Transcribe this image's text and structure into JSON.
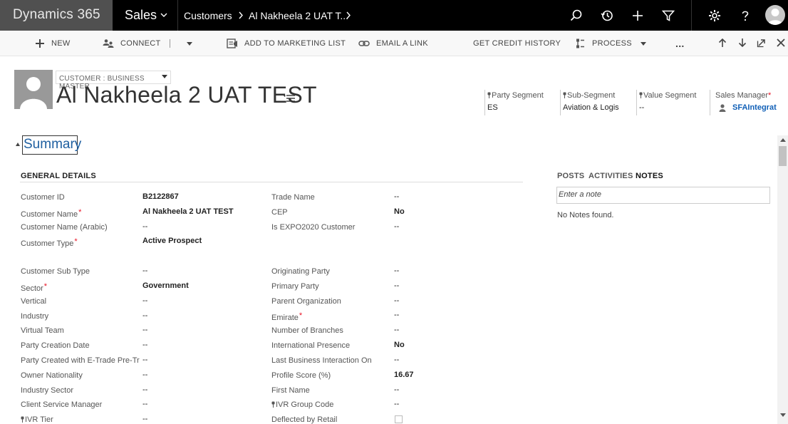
{
  "nav": {
    "brand": "Dynamics 365",
    "area": "Sales",
    "breadcrumb": [
      "Customers",
      "Al Nakheela 2 UAT T..."
    ],
    "icons": [
      "search-icon",
      "history-icon",
      "plus-icon",
      "filter-icon",
      "gear-icon",
      "help-icon",
      "user-avatar"
    ]
  },
  "commands": {
    "new": "NEW",
    "connect": "CONNECT",
    "add_to_marketing_list": "ADD TO MARKETING LIST",
    "email_a_link": "EMAIL A LINK",
    "get_credit_history": "GET CREDIT HISTORY",
    "process": "PROCESS",
    "more": "..."
  },
  "header": {
    "form_selector": "CUSTOMER : BUSINESS MASTER",
    "title": "Al Nakheela 2 UAT TEST",
    "fields": [
      {
        "label": "Party Segment",
        "value": "ES",
        "locked": true
      },
      {
        "label": "Sub-Segment",
        "value": "Aviation & Logis",
        "locked": true
      },
      {
        "label": "Value Segment",
        "value": "--",
        "locked": true
      },
      {
        "label": "Sales Manager",
        "value": "SFAIntegratio",
        "required": true
      }
    ]
  },
  "summary": {
    "title": "Summary",
    "general_details_title": "GENERAL DETAILS",
    "left_fields": [
      {
        "label": "Customer ID",
        "value": "B2122867",
        "bold": true
      },
      {
        "label": "Customer Name",
        "value": "Al Nakheela 2 UAT TEST",
        "bold": true,
        "required": true
      },
      {
        "label": "Customer Name (Arabic)",
        "value": "--"
      },
      {
        "label": "Customer Type",
        "value": "Active Prospect",
        "bold": true,
        "required": true
      },
      {
        "label": "Customer Sub Type",
        "value": "--"
      },
      {
        "label": "Sector",
        "value": "Government",
        "bold": true,
        "required": true
      },
      {
        "label": "Vertical",
        "value": "--"
      },
      {
        "label": "Industry",
        "value": "--"
      },
      {
        "label": "Virtual Team",
        "value": "--"
      },
      {
        "label": "Party Creation Date",
        "value": "--"
      },
      {
        "label": "Party Created with E-Trade Pre-Tr",
        "value": "--"
      },
      {
        "label": "Owner Nationality",
        "value": "--"
      },
      {
        "label": "Industry Sector",
        "value": "--"
      },
      {
        "label": "Client Service Manager",
        "value": "--"
      },
      {
        "label": "IVR Tier",
        "value": "--",
        "locked": true
      }
    ],
    "right_fields": [
      {
        "label": "Trade Name",
        "value": "--"
      },
      {
        "label": "CEP",
        "value": "No",
        "bold": true
      },
      {
        "label": "Is EXPO2020 Customer",
        "value": "--"
      },
      {
        "label": "Originating Party",
        "value": "--"
      },
      {
        "label": "Primary Party",
        "value": "--"
      },
      {
        "label": "Parent Organization",
        "value": "--"
      },
      {
        "label": "Emirate",
        "value": "--",
        "required": true
      },
      {
        "label": "Number of Branches",
        "value": "--"
      },
      {
        "label": "International Presence",
        "value": "No",
        "bold": true
      },
      {
        "label": "Last Business Interaction On",
        "value": "--"
      },
      {
        "label": "Profile Score (%)",
        "value": "16.67",
        "bold": true
      },
      {
        "label": "First Name",
        "value": "--"
      },
      {
        "label": "IVR Group Code",
        "value": "--",
        "locked": true
      },
      {
        "label": "Deflected by Retail",
        "value": ""
      }
    ]
  },
  "notes": {
    "tabs": [
      "POSTS",
      "ACTIVITIES",
      "NOTES"
    ],
    "active_tab": "NOTES",
    "placeholder": "Enter a note",
    "empty_text": "No Notes found."
  }
}
